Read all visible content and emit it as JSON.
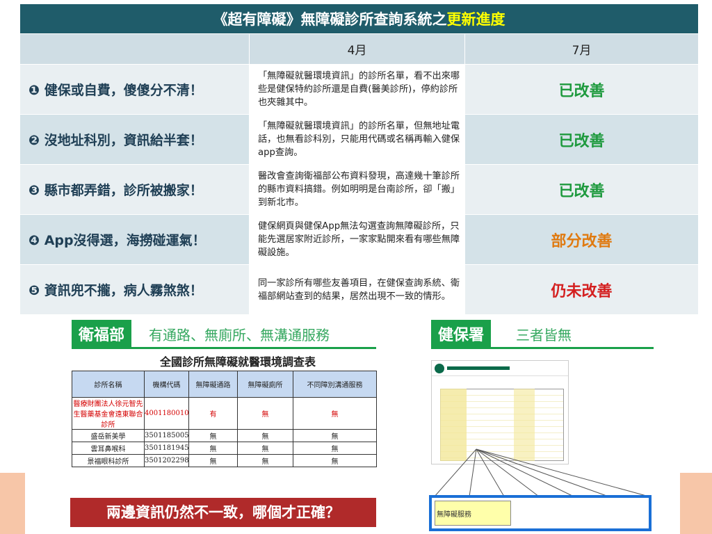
{
  "title": {
    "prefix": "《超有障礙》無障礙診所查詢系統之",
    "highlight": "更新進度"
  },
  "columns": {
    "empty": "",
    "april": "4月",
    "july": "7月"
  },
  "rows": [
    {
      "issue": "❶ 健保或自費，傻傻分不清！",
      "desc": "「無障礙就醫環境資訊」的診所名單，看不出來哪些是健保特約診所還是自費(醫美診所)，停約診所也夾雜其中。",
      "status": "已改善",
      "status_color": "#1e9a3e"
    },
    {
      "issue": "❷ 沒地址科別，資訊給半套！",
      "desc": "「無障礙就醫環境資訊」的診所名單，但無地址電話，也無看診科別，只能用代碼或名稱再輸入健保app查詢。",
      "status": "已改善",
      "status_color": "#1e9a3e"
    },
    {
      "issue": "❸ 縣市都弄錯，診所被搬家！",
      "desc": "醫改會查詢衛福部公布資料發現，高達幾十筆診所的縣市資料搞錯。例如明明是台南診所，卻「搬」到新北市。",
      "status": "已改善",
      "status_color": "#1e9a3e"
    },
    {
      "issue": "❹ App沒得選，海撈碰運氣！",
      "desc": "健保網頁與健保App無法勾選查詢無障礙診所，只能先選居家附近診所，一家家點開來看有哪些無障礙設施。",
      "status": "部分改善",
      "status_color": "#e07a10"
    },
    {
      "issue": "❺ 資訊兜不攏，病人霧煞煞！",
      "desc": "同一家診所有哪些友善項目，在健保查詢系統、衛福部網站查到的結果，居然出現不一致的情形。",
      "status": "仍未改善",
      "status_color": "#d41f1f"
    }
  ],
  "left_panel": {
    "badge": "衛福部",
    "badge_text": "有通路、無廁所、無溝通服務",
    "survey_title": "全國診所無障礙就醫環境調查表",
    "survey_headers": [
      "診所名稱",
      "機構代碼",
      "無障礙通路",
      "無障礙廁所",
      "不同障別溝通服務"
    ],
    "survey_rows": [
      [
        "醫療財團法人徐元智先生醫藥基金會遠東聯合診所",
        "4001180010",
        "有",
        "無",
        "無"
      ],
      [
        "盛岳新美學",
        "3501185005",
        "無",
        "無",
        "無"
      ],
      [
        "雲耳鼻喉科",
        "3501181945",
        "無",
        "無",
        "無"
      ],
      [
        "景福眼科診所",
        "3501202298",
        "無",
        "無",
        "無"
      ]
    ],
    "banner": "兩邊資訊仍然不一致，哪個才正確？"
  },
  "right_panel": {
    "badge": "健保署",
    "badge_text": "三者皆無",
    "zoom_label": "無障礙服務"
  }
}
